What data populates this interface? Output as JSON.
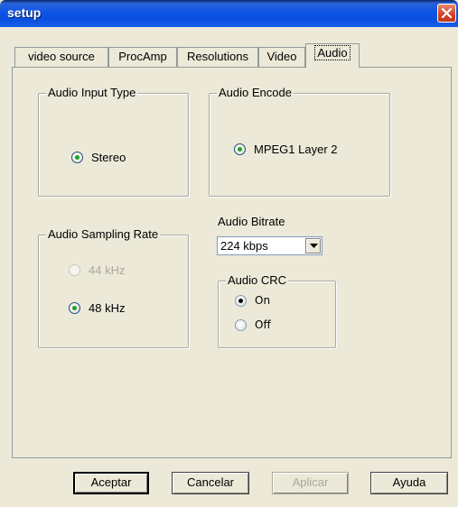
{
  "window": {
    "title": "setup",
    "close_icon": "close-icon"
  },
  "tabs": [
    {
      "label": "video source",
      "active": false
    },
    {
      "label": "ProcAmp",
      "active": false
    },
    {
      "label": "Resolutions",
      "active": false
    },
    {
      "label": "Video",
      "active": false
    },
    {
      "label": "Audio",
      "active": true
    }
  ],
  "audio_input_type": {
    "label": "Audio Input Type",
    "options": [
      {
        "label": "Stereo",
        "checked": true
      }
    ]
  },
  "audio_encode": {
    "label": "Audio Encode",
    "options": [
      {
        "label": "MPEG1 Layer 2",
        "checked": true
      }
    ]
  },
  "audio_sampling_rate": {
    "label": "Audio Sampling Rate",
    "options": [
      {
        "label": "44 kHz",
        "checked": false,
        "disabled": true
      },
      {
        "label": "48 kHz",
        "checked": true,
        "disabled": false
      }
    ]
  },
  "audio_bitrate": {
    "label": "Audio Bitrate",
    "value": "224 kbps",
    "icon": "chevron-down-icon"
  },
  "audio_crc": {
    "label": "Audio CRC",
    "options": [
      {
        "label": "On",
        "checked": true
      },
      {
        "label": "Off",
        "checked": false
      }
    ]
  },
  "buttons": {
    "ok": "Aceptar",
    "cancel": "Cancelar",
    "apply": "Aplicar",
    "help": "Ayuda"
  },
  "colors": {
    "titlebar": "#0a4fe0",
    "window_bg": "#ece9d8",
    "close_button": "#d3462a",
    "radio_check": "#21a121"
  }
}
